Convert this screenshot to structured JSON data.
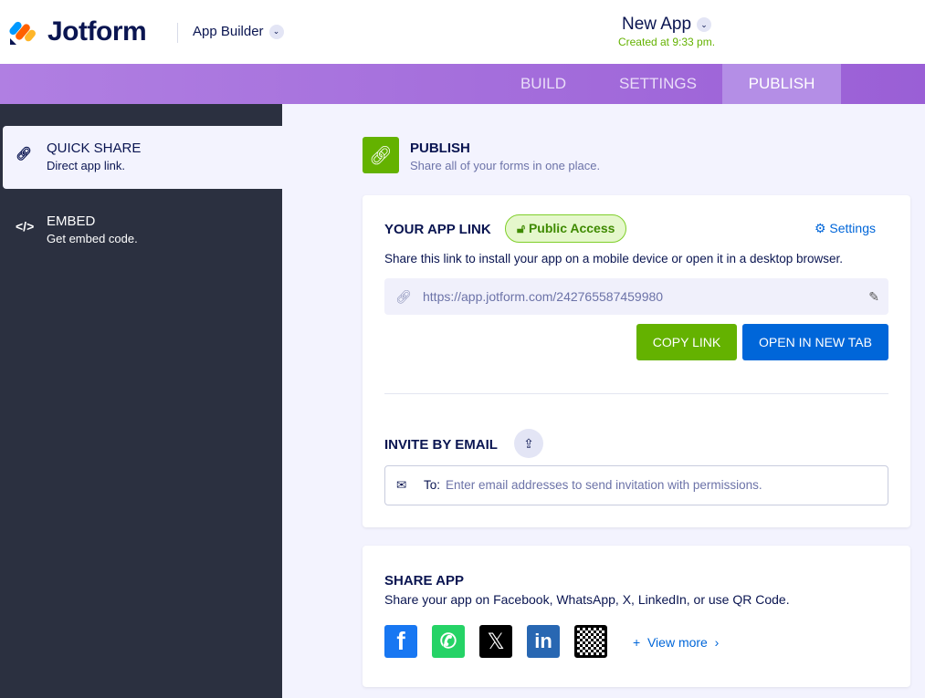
{
  "header": {
    "brand": "Jotform",
    "product": "App Builder",
    "app_title": "New App",
    "created": "Created at 9:33 pm."
  },
  "nav": {
    "tabs": [
      "BUILD",
      "SETTINGS",
      "PUBLISH"
    ],
    "active": "PUBLISH"
  },
  "sidebar": [
    {
      "label": "QUICK SHARE",
      "desc": "Direct app link."
    },
    {
      "label": "EMBED",
      "desc": "Get embed code."
    }
  ],
  "publish": {
    "title": "PUBLISH",
    "subtitle": "Share all of your forms in one place."
  },
  "app_link": {
    "title": "YOUR APP LINK",
    "badge": "Public Access",
    "settings": "Settings",
    "desc": "Share this link to install your app on a mobile device or open it in a desktop browser.",
    "url": "https://app.jotform.com/242765587459980",
    "copy": "COPY LINK",
    "open": "OPEN IN NEW TAB"
  },
  "invite": {
    "title": "INVITE BY EMAIL",
    "to": "To:",
    "placeholder": "Enter email addresses to send invitation with permissions."
  },
  "share": {
    "title": "SHARE APP",
    "desc": "Share your app on Facebook, WhatsApp, X, LinkedIn, or use QR Code.",
    "view_more": "View more"
  },
  "colors": {
    "green": "#64b200",
    "blue": "#0066d9",
    "purple": "#9a5fd6"
  }
}
